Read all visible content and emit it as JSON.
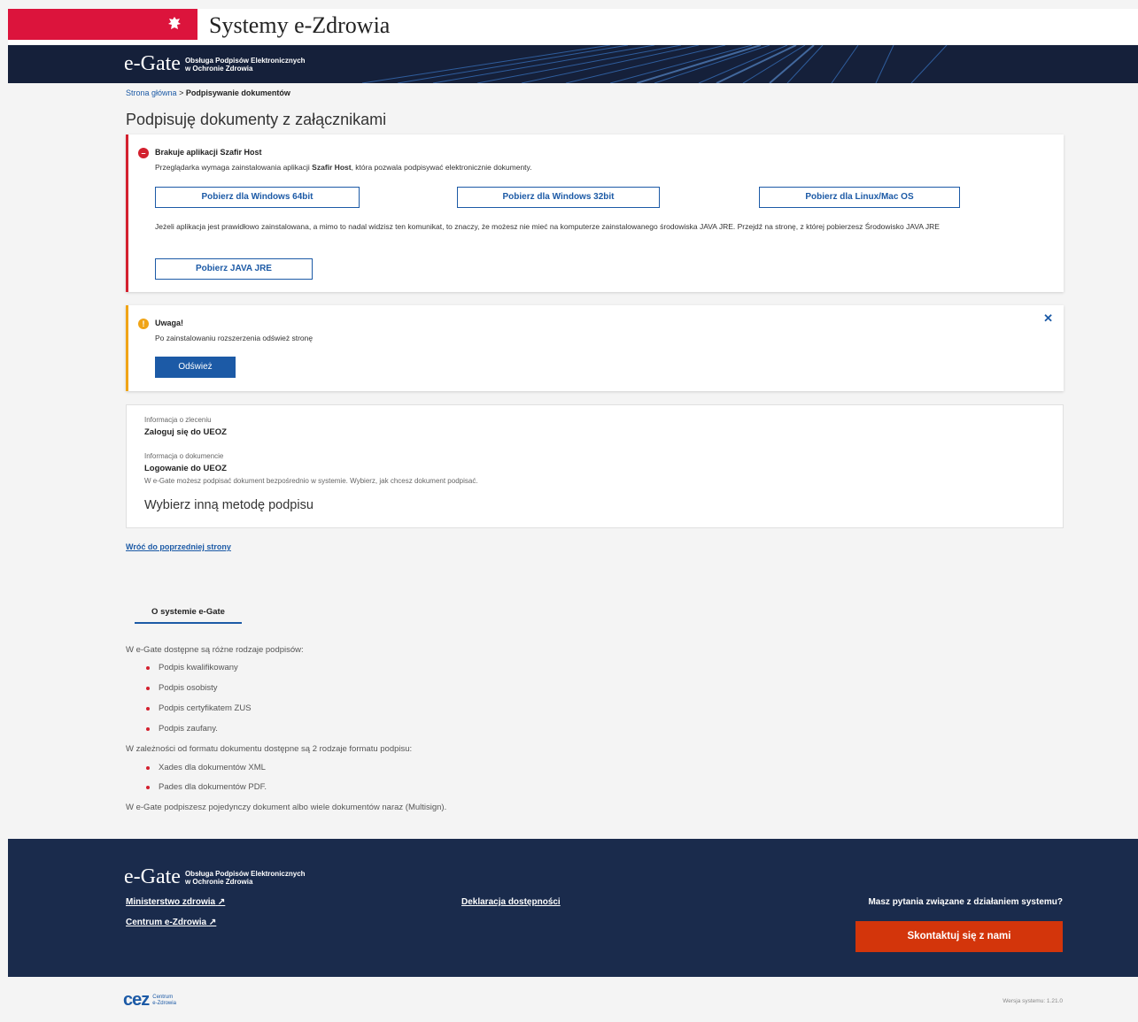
{
  "header": {
    "system_title": "Systemy e-Zdrowia",
    "brand_name": "e-Gate",
    "brand_sub_1": "Obsługa Podpisów Elektronicznych",
    "brand_sub_2": "w Ochronie Zdrowia"
  },
  "breadcrumb": {
    "home": "Strona główna",
    "separator": ">",
    "current": "Podpisywanie dokumentów"
  },
  "page": {
    "title": "Podpisuję dokumenty z załącznikami"
  },
  "error_card": {
    "heading": "Brakuje aplikacji Szafir Host",
    "text_before": "Przeglądarka wymaga zainstalowania aplikacji ",
    "text_bold": "Szafir Host",
    "text_after": ", która pozwala podpisywać elektronicznie dokumenty.",
    "btn_win64": "Pobierz dla Windows 64bit",
    "btn_win32": "Pobierz dla Windows 32bit",
    "btn_linux": "Pobierz dla Linux/Mac OS",
    "java_note": "Jeżeli aplikacja jest prawidłowo zainstalowana, a mimo to nadal widzisz ten komunikat, to znaczy, że możesz nie mieć na komputerze zainstalowanego środowiska JAVA JRE. Przejdź na stronę, z której pobierzesz Środowisko JAVA JRE",
    "btn_java": "Pobierz JAVA JRE",
    "color": "#d3202e"
  },
  "warn_card": {
    "heading": "Uwaga!",
    "text": "Po zainstalowaniu rozszerzenia odśwież stronę",
    "btn_refresh": "Odśwież",
    "close": "✕",
    "color": "#f0a416"
  },
  "info_card": {
    "order_label": "Informacja o zleceniu",
    "order_value": "Zaloguj się do UEOZ",
    "doc_label": "Informacja o dokumencie",
    "doc_value": "Logowanie do UEOZ",
    "note": "W e-Gate możesz podpisać dokument bezpośrednio w systemie. Wybierz, jak chcesz dokument podpisać.",
    "heading": "Wybierz inną metodę podpisu"
  },
  "back_link": "Wróć do poprzedniej strony",
  "about": {
    "tab": "O systemie e-Gate",
    "intro": "W e-Gate dostępne są różne rodzaje podpisów:",
    "signatures": [
      "Podpis kwalifikowany",
      "Podpis osobisty",
      "Podpis certyfikatem ZUS",
      "Podpis zaufany."
    ],
    "format_intro": "W zależności od formatu dokumentu dostępne są 2 rodzaje formatu podpisu:",
    "formats": [
      "Xades dla dokumentów XML",
      "Pades dla dokumentów PDF."
    ],
    "multisign": "W e-Gate podpiszesz pojedynczy dokument albo wiele dokumentów naraz (Multisign)."
  },
  "footer": {
    "link_ministry": "Ministerstwo zdrowia",
    "link_cez": "Centrum e-Zdrowia",
    "link_declaration": "Deklaracja dostępności",
    "question": "Masz pytania związane z działaniem systemu?",
    "contact_btn": "Skontaktuj się z nami",
    "external_icon": "↗",
    "color_bg": "#1a2b4c",
    "color_btn": "#d3350b"
  },
  "bottom": {
    "logo": "cez",
    "logo_sub_1": "Centrum",
    "logo_sub_2": "e-Zdrowia",
    "version": "Wersja systemu: 1.21.0"
  }
}
